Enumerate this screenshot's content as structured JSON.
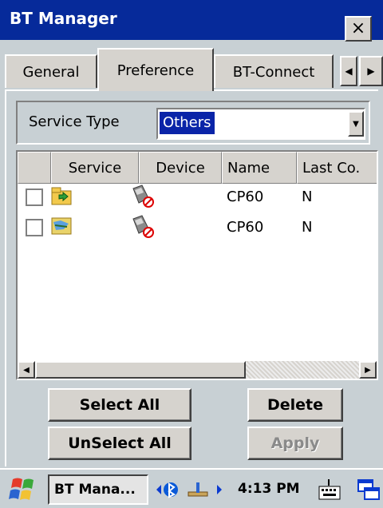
{
  "window": {
    "title": "BT Manager"
  },
  "tabs": [
    {
      "label": "General"
    },
    {
      "label": "Preference"
    },
    {
      "label": "BT-Connect"
    }
  ],
  "service_type": {
    "label": "Service Type",
    "selected": "Others"
  },
  "list": {
    "columns": [
      "",
      "Service",
      "Device",
      "Name",
      "Last Co."
    ],
    "rows": [
      {
        "service_icon": "service-share-icon",
        "device_icon": "pda-device-icon",
        "name": "CP60",
        "last": "N"
      },
      {
        "service_icon": "service-map-icon",
        "device_icon": "pda-device-icon",
        "name": "CP60",
        "last": "N"
      }
    ]
  },
  "buttons": {
    "select_all": "Select All",
    "unselect_all": "UnSelect All",
    "delete": "Delete",
    "apply": "Apply"
  },
  "taskbar": {
    "task_label": "BT Mana...",
    "time": "4:13 PM"
  },
  "colors": {
    "titlebar": "#062a9a",
    "selection": "#0a24a8"
  }
}
